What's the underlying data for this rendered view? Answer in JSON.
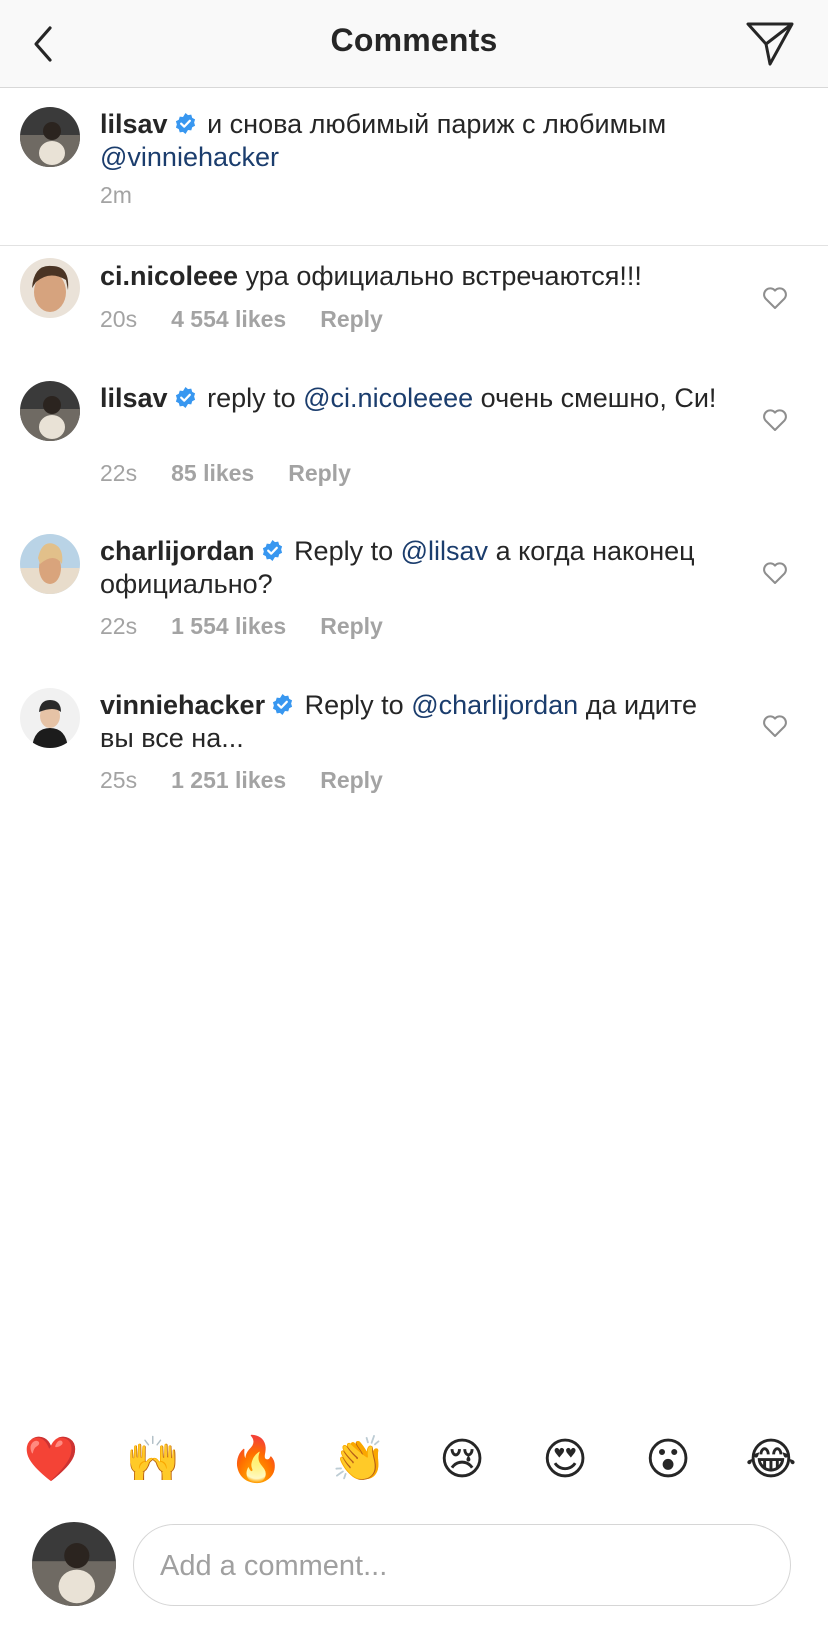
{
  "header": {
    "title": "Comments"
  },
  "caption": {
    "username": "lilsav",
    "text": "и снова любимый париж с любимым",
    "mention": "@vinniehacker",
    "time": "2m"
  },
  "comments": [
    {
      "username": "ci.nicoleee",
      "verified": false,
      "prefix": "",
      "mention": "",
      "text": "ура официально встречаются!!!",
      "time": "20s",
      "likes": "4 554 likes",
      "reply": "Reply"
    },
    {
      "username": "lilsav",
      "verified": true,
      "prefix": "reply to",
      "mention": "@ci.nicoleeee",
      "text": "очень смешно, Си!",
      "time": "22s",
      "likes": "85 likes",
      "reply": "Reply"
    },
    {
      "username": "charlijordan",
      "verified": true,
      "prefix": "Reply to",
      "mention": "@lilsav",
      "text": "а когда наконец официально?",
      "time": "22s",
      "likes": "1 554 likes",
      "reply": "Reply"
    },
    {
      "username": "vinniehacker",
      "verified": true,
      "prefix": "Reply to",
      "mention": "@charlijordan",
      "text": "да идите вы все на...",
      "time": "25s",
      "likes": "1 251 likes",
      "reply": "Reply"
    }
  ],
  "emojis": [
    "❤️",
    "🙌",
    "🔥",
    "👏",
    "😢",
    "😍",
    "😮",
    "😂"
  ],
  "input": {
    "placeholder": "Add a comment..."
  },
  "colors": {
    "mention": "#1b3d6d",
    "verified": "#3897f0",
    "meta": "#a3a3a3"
  }
}
